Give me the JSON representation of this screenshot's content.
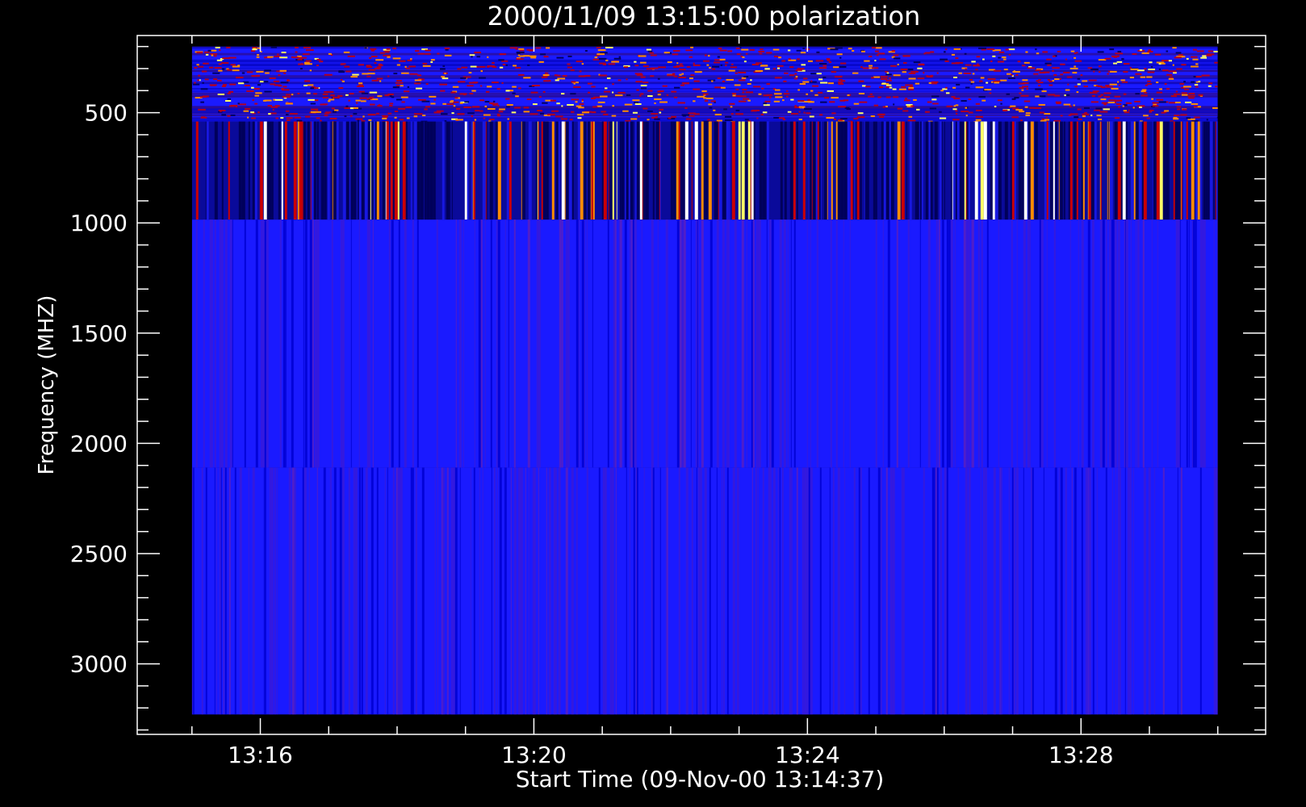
{
  "chart_data": {
    "type": "heatmap",
    "title": "2000/11/09 13:15:00 polarization",
    "xlabel": "Start Time (09-Nov-00 13:14:37)",
    "ylabel": "Frequency (MHZ)",
    "x_ticks": [
      {
        "label": "13:16",
        "minutes": 16
      },
      {
        "label": "13:20",
        "minutes": 20
      },
      {
        "label": "13:24",
        "minutes": 24
      },
      {
        "label": "13:28",
        "minutes": 28
      }
    ],
    "x_range_minutes": [
      14.2,
      30.7
    ],
    "data_time_range_minutes": [
      15.0,
      30.0
    ],
    "y_ticks": [
      500,
      1000,
      1500,
      2000,
      2500,
      3000
    ],
    "y_range": [
      150,
      3320
    ],
    "y_reversed": true,
    "bands": [
      {
        "freq_range": [
          200,
          540
        ],
        "pattern": "noisy-blue-with-red-speckle"
      },
      {
        "freq_range": [
          540,
          985
        ],
        "pattern": "vertical-stripes-red-yellow-white"
      },
      {
        "freq_range": [
          985,
          2110
        ],
        "pattern": "blue-fine-stripes"
      },
      {
        "freq_range": [
          2110,
          3230
        ],
        "pattern": "blue-fine-stripes"
      }
    ],
    "colormap": [
      "#00005a",
      "#2020ff",
      "#cc0000",
      "#ff8c00",
      "#ffff66",
      "#ffffff"
    ],
    "grid": false
  },
  "colors": {
    "background": "#000000",
    "foreground": "#ffffff",
    "base_blue": "#1a1aff"
  }
}
